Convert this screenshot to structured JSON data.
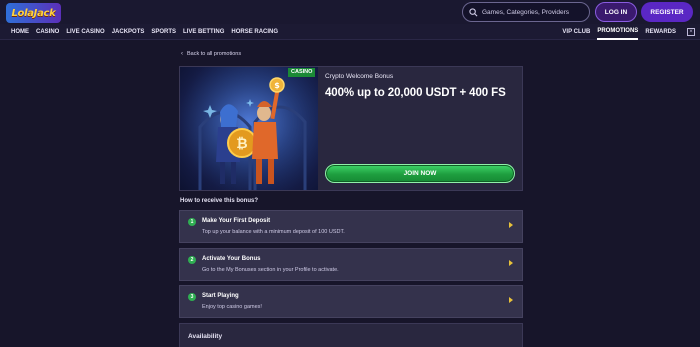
{
  "header": {
    "logo_text": "LolaJack",
    "search_placeholder": "Games, Categories, Providers",
    "login_label": "LOG IN",
    "register_label": "REGISTER"
  },
  "nav": {
    "left": [
      "HOME",
      "CASINO",
      "LIVE CASINO",
      "JACKPOTS",
      "SPORTS",
      "LIVE BETTING",
      "HORSE RACING"
    ],
    "right": [
      "VIP CLUB",
      "PROMOTIONS",
      "REWARDS"
    ],
    "active": "PROMOTIONS",
    "close_glyph": "×"
  },
  "back_link": "Back to all promotions",
  "promo": {
    "badge": "CASINO",
    "subtitle": "Crypto Welcome Bonus",
    "title": "400% up to 20,000 USDT + 400 FS",
    "cta": "JOIN NOW"
  },
  "howto_title": "How to receive this bonus?",
  "steps": [
    {
      "num": "1",
      "title": "Make Your First Deposit",
      "desc": "Top up your balance with a minimum deposit of 100 USDT."
    },
    {
      "num": "2",
      "title": "Activate Your Bonus",
      "desc": "Go to the My Bonuses section in your Profile to activate."
    },
    {
      "num": "3",
      "title": "Start Playing",
      "desc": "Enjoy top casino games!"
    }
  ],
  "availability_title": "Availability",
  "colors": {
    "background": "#17152a",
    "accent_purple": "#5a27c4",
    "accent_green": "#2fae52",
    "arrow_gold": "#e8c23a"
  },
  "icons": {
    "search": "search-icon",
    "back": "chevron-left-icon",
    "step_arrow": "chevron-right-icon",
    "close": "close-icon"
  }
}
